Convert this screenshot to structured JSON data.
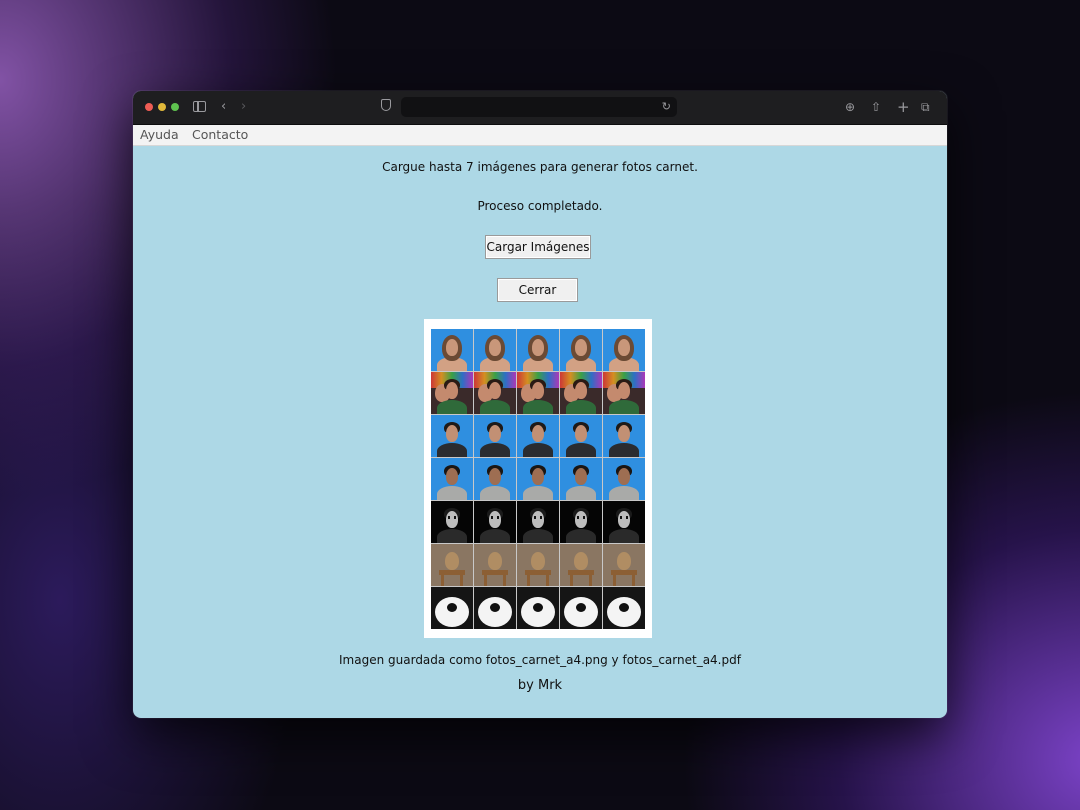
{
  "menu": {
    "items": [
      "Ayuda",
      "Contacto"
    ]
  },
  "main": {
    "instruction": "Cargue hasta 7 imágenes para generar fotos carnet.",
    "status": "Proceso completado.",
    "load_button": "Cargar Imágenes",
    "close_button": "Cerrar",
    "saved_message": "Imagen guardada como fotos_carnet_a4.png y fotos_carnet_a4.pdf",
    "footer": "by Mrk"
  },
  "photo_sheet": {
    "columns": 5,
    "rows": [
      {
        "subject": "woman with long hair, blue background",
        "bg": "#2f8fe0",
        "skin": "#c9977a",
        "hair": "#6b4a34",
        "clothes": "#d2a184"
      },
      {
        "subject": "two people in front of colorful lights",
        "bg": "#3a2a2a",
        "skin": "#c48a6e",
        "hair": "#2a1a14",
        "clothes": "#2f6a3a"
      },
      {
        "subject": "man in dark jacket, blue background",
        "bg": "#2f8fe0",
        "skin": "#c29074",
        "hair": "#1e1a18",
        "clothes": "#2a2c30"
      },
      {
        "subject": "boy in grey hoodie, blue background",
        "bg": "#2f8fe0",
        "skin": "#9e6e52",
        "hair": "#1a1614",
        "clothes": "#a9aaa8"
      },
      {
        "subject": "masked figure on black background",
        "bg": "#050505",
        "skin": "#bdbdbd",
        "hair": "#1a1a1a",
        "clothes": "#2a2a2a"
      },
      {
        "subject": "small dog on wooden stool",
        "bg": "#8a7662",
        "skin": "#b08d63",
        "hair": "#6e5236",
        "clothes": "#8c5f34"
      },
      {
        "subject": "white bird with black head",
        "bg": "#151515",
        "skin": "#f4f4f4",
        "hair": "#111111",
        "clothes": "#e9e9e9"
      }
    ]
  }
}
